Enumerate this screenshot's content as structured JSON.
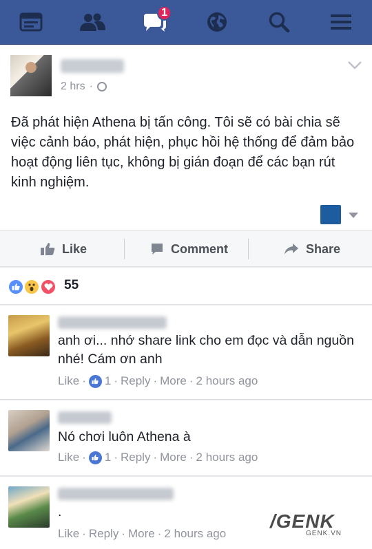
{
  "nav": {
    "icons": [
      "feed-icon",
      "friends-icon",
      "messages-icon",
      "globe-icon",
      "search-icon",
      "menu-icon"
    ],
    "badge_count": "1",
    "bg_color": "#3b5998"
  },
  "post": {
    "time": "2 hrs",
    "text": "Đã phát hiện Athena bị tấn công. Tôi sẽ có bài chia sẽ việc cảnh báo, phát hiện, phục hồi hệ thống để đảm bảo hoạt động liên tục, không bị gián đoạn để các bạn rút kinh nghiệm."
  },
  "actions": {
    "like": "Like",
    "comment": "Comment",
    "share": "Share"
  },
  "reactions": {
    "types": [
      "like",
      "wow",
      "love"
    ],
    "count": "55"
  },
  "comments": [
    {
      "text": "anh ơi... nhớ share link cho em đọc và dẫn nguồn nhé! Cám ơn anh",
      "like": "Like",
      "likes": "1",
      "reply": "Reply",
      "more": "More",
      "time": "2 hours ago"
    },
    {
      "text": "Nó chơi luôn Athena à",
      "like": "Like",
      "likes": "1",
      "reply": "Reply",
      "more": "More",
      "time": "2 hours ago"
    },
    {
      "text": ".",
      "like": "Like",
      "reply": "Reply",
      "more": "More",
      "time": "2 hours ago"
    }
  ],
  "watermark": {
    "brand": "/GENK",
    "site": "GENK.VN"
  }
}
